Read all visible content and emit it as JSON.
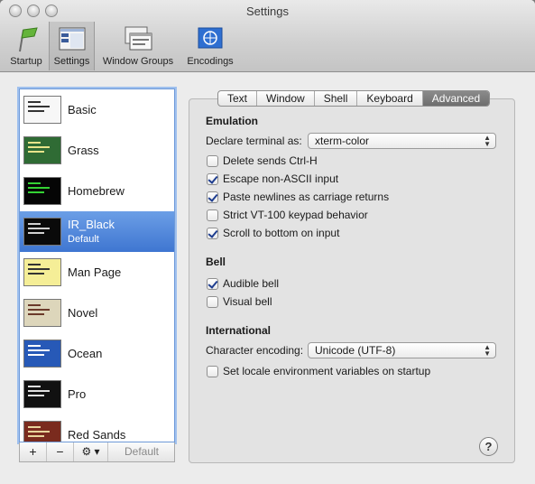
{
  "window": {
    "title": "Settings"
  },
  "toolbar": {
    "items": [
      {
        "label": "Startup",
        "icon": "startup-icon"
      },
      {
        "label": "Settings",
        "icon": "settings-icon",
        "selected": true
      },
      {
        "label": "Window Groups",
        "icon": "window-groups-icon"
      },
      {
        "label": "Encodings",
        "icon": "encodings-icon"
      }
    ]
  },
  "profiles": {
    "items": [
      {
        "name": "Basic",
        "sub": "",
        "thumb_bg": "#f7f7f7",
        "thumb_fg": "#333333"
      },
      {
        "name": "Grass",
        "sub": "",
        "thumb_bg": "#2f6b34",
        "thumb_fg": "#e8e48a"
      },
      {
        "name": "Homebrew",
        "sub": "",
        "thumb_bg": "#050505",
        "thumb_fg": "#34d234"
      },
      {
        "name": "IR_Black",
        "sub": "Default",
        "thumb_bg": "#0a0a0a",
        "thumb_fg": "#d0d0d0"
      },
      {
        "name": "Man Page",
        "sub": "",
        "thumb_bg": "#f5ee97",
        "thumb_fg": "#333333"
      },
      {
        "name": "Novel",
        "sub": "",
        "thumb_bg": "#ddd6bb",
        "thumb_fg": "#6b3a2a"
      },
      {
        "name": "Ocean",
        "sub": "",
        "thumb_bg": "#2759b7",
        "thumb_fg": "#ffffff"
      },
      {
        "name": "Pro",
        "sub": "",
        "thumb_bg": "#111111",
        "thumb_fg": "#e0e0e0"
      },
      {
        "name": "Red Sands",
        "sub": "",
        "thumb_bg": "#7a2b1e",
        "thumb_fg": "#e8d49c"
      }
    ],
    "selected_index": 3
  },
  "list_buttons": {
    "add": "+",
    "remove": "−",
    "gear": "⚙ ▾",
    "default": "Default"
  },
  "tabs": [
    "Text",
    "Window",
    "Shell",
    "Keyboard",
    "Advanced"
  ],
  "active_tab": "Advanced",
  "emulation": {
    "heading": "Emulation",
    "declare_label": "Declare terminal as:",
    "declare_value": "xterm-color",
    "options": [
      {
        "label": "Delete sends Ctrl-H",
        "checked": false
      },
      {
        "label": "Escape non-ASCII input",
        "checked": true
      },
      {
        "label": "Paste newlines as carriage returns",
        "checked": true
      },
      {
        "label": "Strict VT-100 keypad behavior",
        "checked": false
      },
      {
        "label": "Scroll to bottom on input",
        "checked": true
      }
    ]
  },
  "bell": {
    "heading": "Bell",
    "options": [
      {
        "label": "Audible bell",
        "checked": true
      },
      {
        "label": "Visual bell",
        "checked": false
      }
    ]
  },
  "international": {
    "heading": "International",
    "encoding_label": "Character encoding:",
    "encoding_value": "Unicode (UTF-8)",
    "locale_label": "Set locale environment variables on startup",
    "locale_checked": false
  },
  "help": "?"
}
